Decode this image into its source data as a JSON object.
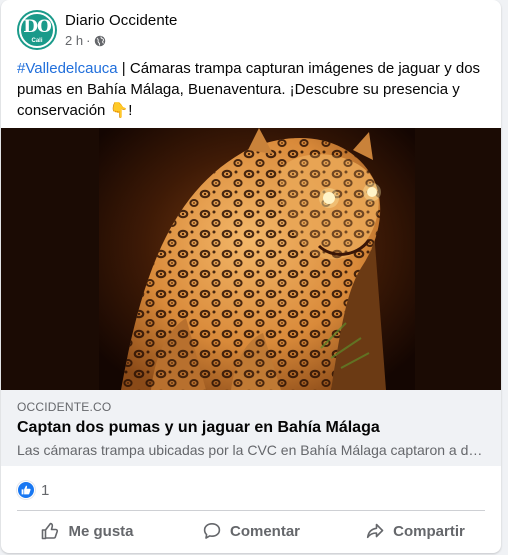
{
  "post": {
    "page_name": "Diario Occidente",
    "time": "2 h",
    "separator": "·",
    "privacy_icon": "globe-icon",
    "avatar_monogram": "DO",
    "avatar_city": "Cali",
    "caption_hashtag": "#Valledelcauca",
    "caption_text": " | Cámaras trampa capturan imágenes de jaguar y dos pumas en Bahía Málaga, Buenaventura. ¡Descubre su presencia y conservación 👇!"
  },
  "link_preview": {
    "domain": "OCCIDENTE.CO",
    "title": "Captan dos pumas y un jaguar en Bahía Málaga",
    "description": "Las cámaras trampa ubicadas por la CVC en Bahía Málaga captaron a dos pumas y un jaguar en su hábitat natural."
  },
  "reactions": {
    "icon": "like-icon",
    "count": "1"
  },
  "actions": {
    "like_label": "Me gusta",
    "comment_label": "Comentar",
    "share_label": "Compartir"
  },
  "colors": {
    "accent": "#1877f2",
    "hashtag": "#216fdb",
    "secondary_text": "#65676b",
    "avatar_bg": "#1a9a8a"
  }
}
